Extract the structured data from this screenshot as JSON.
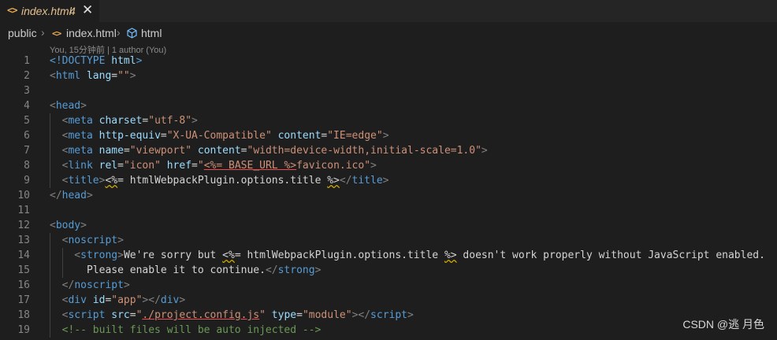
{
  "tab": {
    "label": "index.html",
    "count": "4",
    "icon": "html-file-icon",
    "close": "✕"
  },
  "breadcrumb": {
    "folder": "public",
    "file": "index.html",
    "element": "html"
  },
  "blame": "You, 15分钟前 | 1 author (You)",
  "lines": [
    {
      "n": "1",
      "tokens": [
        {
          "t": "<!DOCTYPE ",
          "c": "tag"
        },
        {
          "t": "html",
          "c": "attr"
        },
        {
          "t": ">",
          "c": "tag"
        }
      ]
    },
    {
      "n": "2",
      "tokens": [
        {
          "t": "<",
          "c": "pun"
        },
        {
          "t": "html",
          "c": "tag"
        },
        {
          "t": " lang",
          "c": "attr"
        },
        {
          "t": "=",
          "c": "txt"
        },
        {
          "t": "\"\"",
          "c": "str"
        },
        {
          "t": ">",
          "c": "pun"
        }
      ]
    },
    {
      "n": "3",
      "tokens": []
    },
    {
      "n": "4",
      "tokens": [
        {
          "t": "<",
          "c": "pun"
        },
        {
          "t": "head",
          "c": "tag"
        },
        {
          "t": ">",
          "c": "pun"
        }
      ]
    },
    {
      "n": "5",
      "tokens": [
        {
          "t": "  <",
          "c": "pun"
        },
        {
          "t": "meta",
          "c": "tag"
        },
        {
          "t": " charset",
          "c": "attr"
        },
        {
          "t": "=",
          "c": "txt"
        },
        {
          "t": "\"utf-8\"",
          "c": "str"
        },
        {
          "t": ">",
          "c": "pun"
        }
      ]
    },
    {
      "n": "6",
      "tokens": [
        {
          "t": "  <",
          "c": "pun"
        },
        {
          "t": "meta",
          "c": "tag"
        },
        {
          "t": " http-equiv",
          "c": "attr"
        },
        {
          "t": "=",
          "c": "txt"
        },
        {
          "t": "\"X-UA-Compatible\"",
          "c": "str"
        },
        {
          "t": " content",
          "c": "attr"
        },
        {
          "t": "=",
          "c": "txt"
        },
        {
          "t": "\"IE=edge\"",
          "c": "str"
        },
        {
          "t": ">",
          "c": "pun"
        }
      ]
    },
    {
      "n": "7",
      "tokens": [
        {
          "t": "  <",
          "c": "pun"
        },
        {
          "t": "meta",
          "c": "tag"
        },
        {
          "t": " name",
          "c": "attr"
        },
        {
          "t": "=",
          "c": "txt"
        },
        {
          "t": "\"viewport\"",
          "c": "str"
        },
        {
          "t": " content",
          "c": "attr"
        },
        {
          "t": "=",
          "c": "txt"
        },
        {
          "t": "\"width=device-width,initial-scale=1.0\"",
          "c": "str"
        },
        {
          "t": ">",
          "c": "pun"
        }
      ]
    },
    {
      "n": "8",
      "tokens": [
        {
          "t": "  <",
          "c": "pun"
        },
        {
          "t": "link",
          "c": "tag"
        },
        {
          "t": " rel",
          "c": "attr"
        },
        {
          "t": "=",
          "c": "txt"
        },
        {
          "t": "\"icon\"",
          "c": "str"
        },
        {
          "t": " href",
          "c": "attr"
        },
        {
          "t": "=",
          "c": "txt"
        },
        {
          "t": "\"",
          "c": "str"
        },
        {
          "t": "<%= BASE_URL %>",
          "c": "str",
          "u": "ejs"
        },
        {
          "t": "favicon.ico\"",
          "c": "str"
        },
        {
          "t": ">",
          "c": "pun"
        }
      ]
    },
    {
      "n": "9",
      "tokens": [
        {
          "t": "  <",
          "c": "pun"
        },
        {
          "t": "title",
          "c": "tag"
        },
        {
          "t": ">",
          "c": "pun"
        },
        {
          "t": "<%",
          "c": "txt",
          "u": "squig"
        },
        {
          "t": "= htmlWebpackPlugin.options.title ",
          "c": "txt"
        },
        {
          "t": "%>",
          "c": "txt",
          "u": "squig"
        },
        {
          "t": "</",
          "c": "pun"
        },
        {
          "t": "title",
          "c": "tag"
        },
        {
          "t": ">",
          "c": "pun"
        }
      ]
    },
    {
      "n": "10",
      "tokens": [
        {
          "t": "</",
          "c": "pun"
        },
        {
          "t": "head",
          "c": "tag"
        },
        {
          "t": ">",
          "c": "pun"
        }
      ]
    },
    {
      "n": "11",
      "tokens": []
    },
    {
      "n": "12",
      "tokens": [
        {
          "t": "<",
          "c": "pun"
        },
        {
          "t": "body",
          "c": "tag"
        },
        {
          "t": ">",
          "c": "pun"
        }
      ]
    },
    {
      "n": "13",
      "tokens": [
        {
          "t": "  <",
          "c": "pun"
        },
        {
          "t": "noscript",
          "c": "tag"
        },
        {
          "t": ">",
          "c": "pun"
        }
      ]
    },
    {
      "n": "14",
      "tokens": [
        {
          "t": "    <",
          "c": "pun"
        },
        {
          "t": "strong",
          "c": "tag"
        },
        {
          "t": ">",
          "c": "pun"
        },
        {
          "t": "We're sorry but ",
          "c": "txt"
        },
        {
          "t": "<%",
          "c": "txt",
          "u": "squig"
        },
        {
          "t": "= htmlWebpackPlugin.options.title ",
          "c": "txt"
        },
        {
          "t": "%>",
          "c": "txt",
          "u": "squig"
        },
        {
          "t": " doesn't work properly without JavaScript enabled.",
          "c": "txt"
        }
      ]
    },
    {
      "n": "15",
      "tokens": [
        {
          "t": "      Please enable it to continue.",
          "c": "txt"
        },
        {
          "t": "</",
          "c": "pun"
        },
        {
          "t": "strong",
          "c": "tag"
        },
        {
          "t": ">",
          "c": "pun"
        }
      ]
    },
    {
      "n": "16",
      "tokens": [
        {
          "t": "  </",
          "c": "pun"
        },
        {
          "t": "noscript",
          "c": "tag"
        },
        {
          "t": ">",
          "c": "pun"
        }
      ]
    },
    {
      "n": "17",
      "tokens": [
        {
          "t": "  <",
          "c": "pun"
        },
        {
          "t": "div",
          "c": "tag"
        },
        {
          "t": " id",
          "c": "attr"
        },
        {
          "t": "=",
          "c": "txt"
        },
        {
          "t": "\"app\"",
          "c": "str"
        },
        {
          "t": "></",
          "c": "pun"
        },
        {
          "t": "div",
          "c": "tag"
        },
        {
          "t": ">",
          "c": "pun"
        }
      ]
    },
    {
      "n": "18",
      "tokens": [
        {
          "t": "  <",
          "c": "pun"
        },
        {
          "t": "script",
          "c": "tag"
        },
        {
          "t": " src",
          "c": "attr"
        },
        {
          "t": "=",
          "c": "txt"
        },
        {
          "t": "\"",
          "c": "str"
        },
        {
          "t": "./project.config.js",
          "c": "str",
          "u": "ejs"
        },
        {
          "t": "\"",
          "c": "str"
        },
        {
          "t": " type",
          "c": "attr"
        },
        {
          "t": "=",
          "c": "txt"
        },
        {
          "t": "\"module\"",
          "c": "str"
        },
        {
          "t": "></",
          "c": "pun"
        },
        {
          "t": "script",
          "c": "tag"
        },
        {
          "t": ">",
          "c": "pun"
        }
      ]
    },
    {
      "n": "19",
      "tokens": [
        {
          "t": "  <!-- built files will be auto injected -->",
          "c": "com"
        }
      ]
    }
  ],
  "watermark": "CSDN @逃 月色",
  "colors": {
    "tag": "#569cd6",
    "attr": "#9cdcfe",
    "str": "#ce9178",
    "comment": "#6a9955",
    "text": "#d4d4d4"
  }
}
